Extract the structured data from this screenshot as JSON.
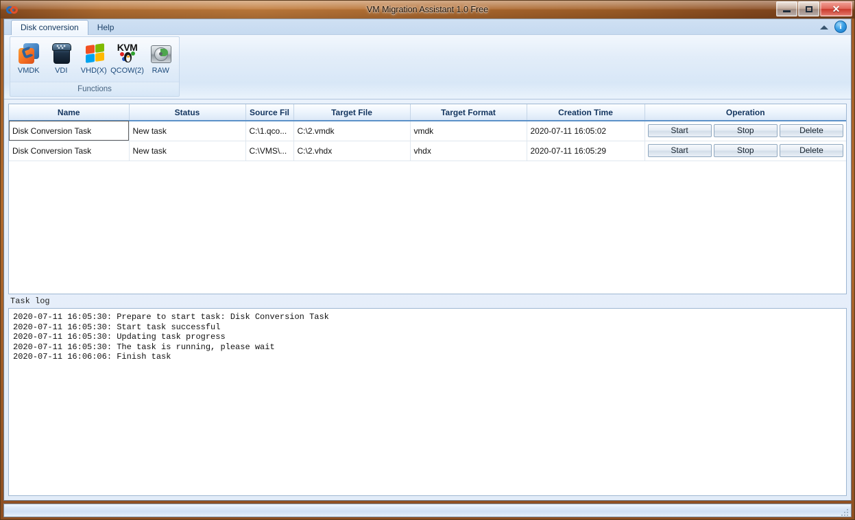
{
  "window": {
    "title": "VM Migration Assistant 1.0 Free",
    "app_icon": "vm-migration-logo-icon",
    "minimize_label": "",
    "maximize_label": "",
    "close_label": "✕",
    "accent_title_color": "#b06a2e",
    "selection_color": "#1f90ff"
  },
  "tabs": [
    {
      "label": "Disk conversion",
      "active": true
    },
    {
      "label": "Help",
      "active": false
    }
  ],
  "tabstrip_right": {
    "minimize_ribbon_icon": "chevron-up-icon",
    "info_icon": "info-icon",
    "info_glyph": "i"
  },
  "ribbon": {
    "group_title": "Functions",
    "buttons": [
      {
        "label": "VMDK",
        "icon": "vmware-vmdk-icon"
      },
      {
        "label": "VDI",
        "icon": "virtualbox-vdi-icon"
      },
      {
        "label": "VHD(X)",
        "icon": "windows-vhd-icon"
      },
      {
        "label": "QCOW(2)",
        "icon": "kvm-qcow-icon",
        "icon_text": "KVM"
      },
      {
        "label": "RAW",
        "icon": "harddisk-raw-icon"
      }
    ]
  },
  "table": {
    "columns": [
      {
        "key": "name",
        "label": "Name"
      },
      {
        "key": "status",
        "label": "Status"
      },
      {
        "key": "source_file",
        "label": "Source Fil"
      },
      {
        "key": "target_file",
        "label": "Target File"
      },
      {
        "key": "target_format",
        "label": "Target Format"
      },
      {
        "key": "creation_time",
        "label": "Creation Time"
      },
      {
        "key": "operation",
        "label": "Operation"
      }
    ],
    "operation_buttons": [
      "Start",
      "Stop",
      "Delete"
    ],
    "rows": [
      {
        "name": "Disk Conversion Task",
        "status": "New task",
        "source_file": "C:\\1.qco...",
        "target_file": "C:\\2.vmdk",
        "target_format": "vmdk",
        "creation_time": "2020-07-11 16:05:02",
        "selected": true
      },
      {
        "name": "Disk Conversion Task",
        "status": "New task",
        "source_file": "C:\\VMS\\...",
        "target_file": "C:\\2.vhdx",
        "target_format": "vhdx",
        "creation_time": "2020-07-11 16:05:29",
        "selected": false
      }
    ]
  },
  "log": {
    "label": "Task log",
    "lines": [
      "2020-07-11 16:05:30: Prepare to start task: Disk Conversion Task",
      "2020-07-11 16:05:30: Start task successful",
      "2020-07-11 16:05:30: Updating task progress",
      "2020-07-11 16:05:30: The task is running, please wait",
      "2020-07-11 16:06:06: Finish task"
    ]
  },
  "statusbar": {
    "text": "",
    "grip_icon": "resize-grip-icon"
  }
}
